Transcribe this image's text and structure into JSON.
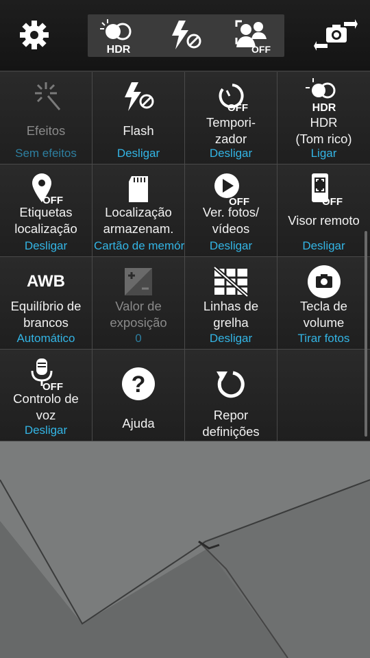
{
  "topbar": {
    "settings_icon": "gear-icon",
    "hdr_icon": "hdr-icon",
    "hdr_text": "HDR",
    "flash_icon": "flash-off-icon",
    "face_icon": "face-detection-icon",
    "face_text": "OFF",
    "switch_camera_icon": "switch-camera-icon"
  },
  "settings": [
    {
      "label": "Efeitos",
      "value": "Sem efeitos",
      "icon": "effects-icon",
      "disabled": true
    },
    {
      "label": "Flash",
      "value": "Desligar",
      "icon": "flash-off-icon"
    },
    {
      "label": "Tempori-\nzador",
      "value": "Desligar",
      "icon": "timer-icon",
      "icon_text": "OFF"
    },
    {
      "label": "HDR\n(Tom rico)",
      "value": "Ligar",
      "icon": "hdr-icon",
      "icon_text": "HDR"
    },
    {
      "label": "Etiquetas\nlocalização",
      "value": "Desligar",
      "icon": "location-tag-icon",
      "icon_text": "OFF"
    },
    {
      "label": "Localização\narmazenam.",
      "value": "Cartão de memória",
      "icon": "sd-card-icon"
    },
    {
      "label": "Ver. fotos/\nvídeos",
      "value": "Desligar",
      "icon": "review-icon",
      "icon_text": "OFF"
    },
    {
      "label": "Visor remoto",
      "value": "Desligar",
      "icon": "remote-viewfinder-icon",
      "icon_text": "OFF"
    },
    {
      "label": "Equilíbrio de\nbrancos",
      "value": "Automático",
      "icon": "awb-icon",
      "icon_text": "AWB"
    },
    {
      "label": "Valor de\nexposição",
      "value": "0",
      "icon": "exposure-icon",
      "disabled": true
    },
    {
      "label": "Linhas de\ngrelha",
      "value": "Desligar",
      "icon": "grid-lines-icon"
    },
    {
      "label": "Tecla de\nvolume",
      "value": "Tirar fotos",
      "icon": "volume-key-camera-icon"
    },
    {
      "label": "Controlo de\nvoz",
      "value": "Desligar",
      "icon": "voice-control-icon",
      "icon_text": "OFF"
    },
    {
      "label": "Ajuda",
      "value": "",
      "icon": "help-icon",
      "icon_text": "?"
    },
    {
      "label": "Repor\ndefinições",
      "value": "",
      "icon": "reset-icon"
    },
    {
      "label": "",
      "value": "",
      "icon": ""
    }
  ],
  "colors": {
    "accent": "#33b5e5",
    "panel": "#202020",
    "text": "#f2f2f2"
  }
}
